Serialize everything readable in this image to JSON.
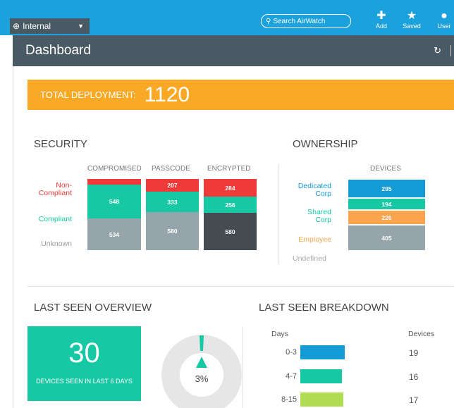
{
  "topbar": {
    "org_label": "Internal",
    "search_label": "Search AirWatch",
    "add_label": "Add",
    "saved_label": "Saved",
    "user_label": "User"
  },
  "header": {
    "title": "Dashboard"
  },
  "deployment": {
    "label": "TOTAL DEPLOYMENT:",
    "value": "1120"
  },
  "security": {
    "title": "SECURITY",
    "columns": [
      "COMPROMISED",
      "PASSCODE",
      "ENCRYPTED"
    ],
    "row_labels": {
      "noncompliant": "Non-\nCompliant",
      "noncompliant_line1": "Non-",
      "noncompliant_line2": "Compliant",
      "compliant": "Compliant",
      "unknown": "Unknown"
    },
    "values": {
      "compromised": {
        "noncompliant": "",
        "compliant": "548",
        "unknown": "534"
      },
      "passcode": {
        "noncompliant": "207",
        "compliant": "333",
        "unknown": "580"
      },
      "encrypted": {
        "noncompliant": "284",
        "compliant": "256",
        "unknown": "580"
      }
    }
  },
  "ownership": {
    "title": "OWNERSHIP",
    "column": "DEVICES",
    "labels": {
      "dedicated1": "Dedicated",
      "dedicated2": "Corp",
      "shared1": "Shared",
      "shared2": "Corp",
      "employee": "Employee",
      "undefined": "Undefined"
    },
    "values": {
      "dedicated": "295",
      "shared": "194",
      "employee": "226",
      "undefined": "405"
    }
  },
  "last_seen_overview": {
    "title": "LAST SEEN OVERVIEW",
    "count": "30",
    "caption": "DEVICES SEEN IN LAST 6 DAYS",
    "percent": "3%"
  },
  "last_seen_breakdown": {
    "title": "LAST SEEN BREAKDOWN",
    "days_header": "Days",
    "devices_header": "Devices",
    "rows": [
      {
        "days": "0-3",
        "devices": "19"
      },
      {
        "days": "4-7",
        "devices": "16"
      },
      {
        "days": "8-15",
        "devices": "17"
      }
    ]
  },
  "colors": {
    "topbar": "#1ba1dc",
    "header": "#4a5a64",
    "deployment": "#faa926",
    "noncompliant": "#f03a3a",
    "compliant": "#17c8a4",
    "unknown": "#96a5ab",
    "encrypted_unknown": "#454b51",
    "dedicated": "#139bd6",
    "shared": "#17c8a4",
    "employee": "#faa44e",
    "undefined": "#96a5ab",
    "days_0_3": "#139bd6",
    "days_4_7": "#17c8a4",
    "days_8_15": "#b1dd55"
  }
}
